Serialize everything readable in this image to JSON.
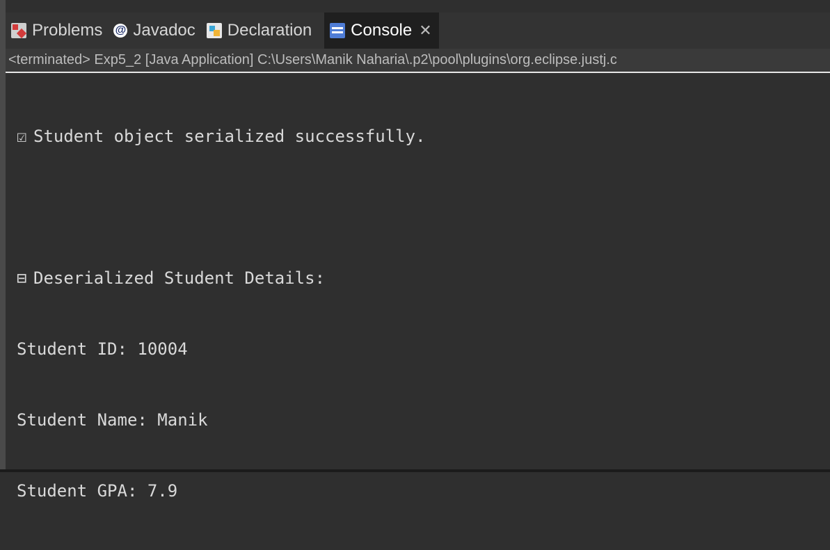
{
  "tabs": [
    {
      "label": "Problems",
      "icon": "problems-icon",
      "active": false
    },
    {
      "label": "Javadoc",
      "icon": "javadoc-icon",
      "active": false
    },
    {
      "label": "Declaration",
      "icon": "declaration-icon",
      "active": false
    },
    {
      "label": "Console",
      "icon": "console-icon",
      "active": true
    }
  ],
  "close_glyph": "✕",
  "status": "<terminated> Exp5_2 [Java Application] C:\\Users\\Manik Naharia\\.p2\\pool\\plugins\\org.eclipse.justj.c",
  "console": {
    "lines": [
      {
        "icon": "☑",
        "text": "Student object serialized successfully."
      },
      {
        "icon": "",
        "text": ""
      },
      {
        "icon": "⊟",
        "text": "Deserialized Student Details:"
      },
      {
        "icon": "",
        "text": "Student ID: 10004"
      },
      {
        "icon": "",
        "text": "Student Name: Manik"
      },
      {
        "icon": "",
        "text": "Student GPA: 7.9"
      }
    ]
  },
  "colors": {
    "background": "#2f2f2f",
    "tabbar": "#333333",
    "active_tab": "#1f1f1f",
    "console_accent": "#4f7dd6"
  }
}
